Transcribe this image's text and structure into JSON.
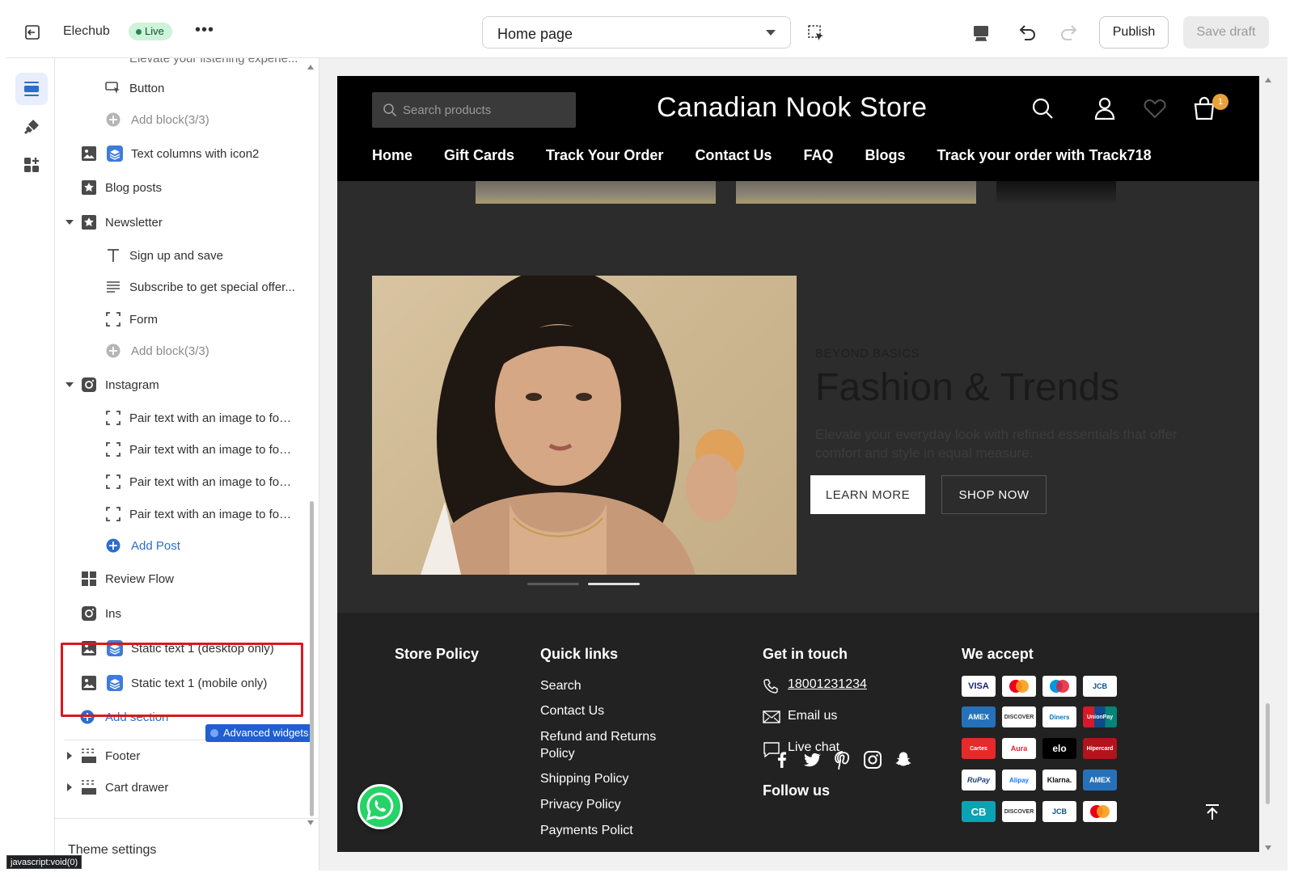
{
  "topbar": {
    "store_name": "Elechub",
    "status": "Live",
    "more": "•••",
    "template_select": "Home page",
    "publish_label": "Publish",
    "save_label": "Save draft"
  },
  "rail": {
    "items": [
      {
        "icon": "sections-icon",
        "active": true
      },
      {
        "icon": "theme-settings-brush-icon",
        "active": false
      },
      {
        "icon": "app-blocks-icon",
        "active": false
      }
    ]
  },
  "sidebar": {
    "rows": {
      "truncated_top": "Elevate your listening experie...",
      "button": "Button",
      "add_block_1": "Add block(3/3)",
      "text_columns": "Text columns with icon2",
      "blog_posts": "Blog posts",
      "newsletter": "Newsletter",
      "sign_up": "Sign up and save",
      "subscribe": "Subscribe to get special offer...",
      "form": "Form",
      "add_block_2": "Add block(3/3)",
      "instagram": "Instagram",
      "pair_1": "Pair text with an image to foc...",
      "pair_2": "Pair text with an image to foc...",
      "pair_3": "Pair text with an image to foc...",
      "pair_4": "Pair text with an image to foc...",
      "add_post": "Add Post",
      "review_flow": "Review Flow",
      "ins": "Ins",
      "static_desktop": "Static text 1 (desktop only)",
      "static_mobile": "Static text 1 (mobile only)",
      "add_section": "Add section",
      "advanced_widgets": "Advanced widgets",
      "footer": "Footer",
      "cart_drawer": "Cart drawer"
    },
    "theme_settings": "Theme settings",
    "status_url": "javascript:void(0)"
  },
  "preview": {
    "search_placeholder": "Search products",
    "store_title": "Canadian Nook Store",
    "cart_count": "1",
    "nav": [
      "Home",
      "Gift Cards",
      "Track Your Order",
      "Contact Us",
      "FAQ",
      "Blogs",
      "Track your order with Track718"
    ],
    "banner": {
      "eyebrow": "BEYOND BASICS",
      "headline": "Fashion & Trends",
      "description": "Elevate your everyday look with refined essentials that offer comfort and style in equal measure.",
      "learn_more": "LEARN MORE",
      "shop_now": "SHOP NOW"
    },
    "footer": {
      "store_policy": "Store Policy",
      "quick_links_title": "Quick links",
      "quick_links": [
        "Search",
        "Contact Us",
        "Refund and Returns Policy",
        "Shipping Policy",
        "Privacy Policy",
        "Payments Polict"
      ],
      "get_in_touch": "Get in touch",
      "phone": "18001231234",
      "email": "Email us",
      "chat": "Live chat",
      "follow_us": "Follow us",
      "we_accept": "We accept",
      "payment_methods": [
        "VISA",
        "Mastercard",
        "Maestro",
        "JCB",
        "AMEX",
        "DISCOVER",
        "Diners",
        "UnionPay",
        "Cartes",
        "Aura",
        "elo",
        "Hipercard",
        "RuPay",
        "Alipay",
        "Klarna.",
        "AMEX",
        "CB",
        "DISCOVER",
        "JCB",
        "Mastercard"
      ]
    }
  },
  "colors": {
    "accent_blue": "#2c6ecb",
    "highlight_red": "#d7191c",
    "live_green": "#29845a",
    "store_bg": "#2c2c2c",
    "footer_bg": "#222222"
  }
}
